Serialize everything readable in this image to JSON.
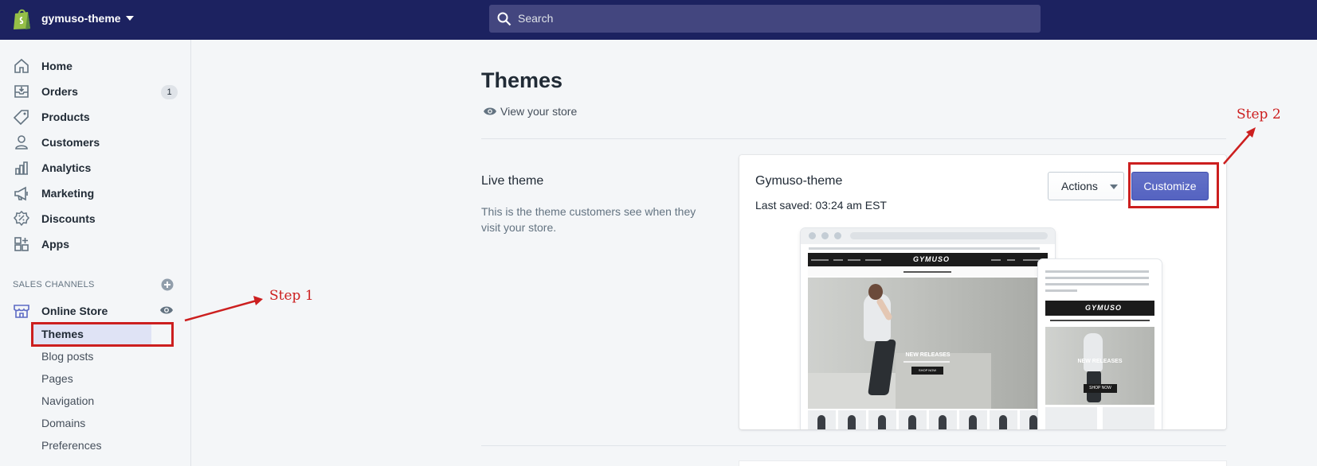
{
  "topbar": {
    "store_name": "gymuso-theme",
    "search_placeholder": "Search"
  },
  "sidebar": {
    "items": [
      {
        "label": "Home",
        "icon": "home-icon"
      },
      {
        "label": "Orders",
        "icon": "orders-icon",
        "badge": "1"
      },
      {
        "label": "Products",
        "icon": "tag-icon"
      },
      {
        "label": "Customers",
        "icon": "person-icon"
      },
      {
        "label": "Analytics",
        "icon": "bar-chart-icon"
      },
      {
        "label": "Marketing",
        "icon": "megaphone-icon"
      },
      {
        "label": "Discounts",
        "icon": "discount-icon"
      },
      {
        "label": "Apps",
        "icon": "apps-icon"
      }
    ],
    "sales_channels_heading": "SALES CHANNELS",
    "online_store_label": "Online Store",
    "sub_items": [
      "Themes",
      "Blog posts",
      "Pages",
      "Navigation",
      "Domains",
      "Preferences"
    ],
    "active_sub_item": "Themes"
  },
  "main": {
    "title": "Themes",
    "view_store_label": "View your store",
    "live_theme_heading": "Live theme",
    "live_theme_desc": "This is the theme customers see when they visit your store.",
    "theme_name": "Gymuso-theme",
    "last_saved": "Last saved: 03:24 am EST",
    "actions_label": "Actions",
    "customize_label": "Customize"
  },
  "preview": {
    "logo_text": "GYMUSO",
    "hero_title": "NEW RELEASES",
    "hero_button": "SHOP NOW"
  },
  "annotations": {
    "step1": "Step 1",
    "step2": "Step 2"
  },
  "colors": {
    "topbar": "#1c2260",
    "primary_button": "#5c6ac4",
    "annotation": "#cc1f1f"
  }
}
